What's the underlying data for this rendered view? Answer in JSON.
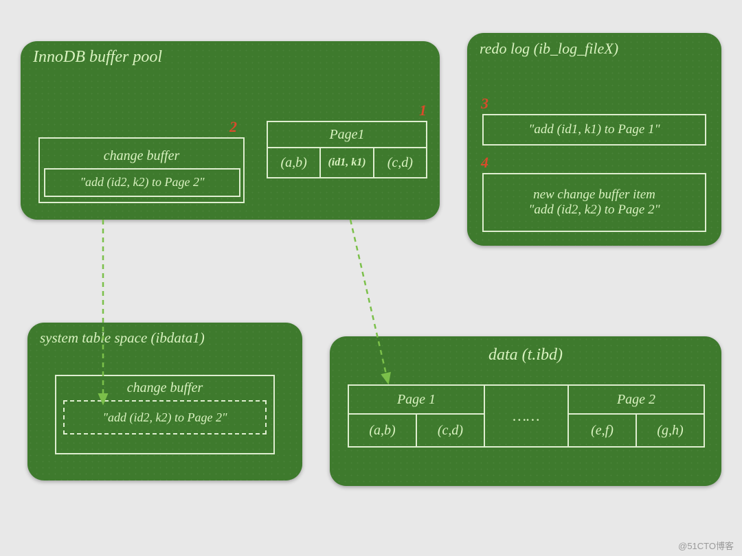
{
  "watermark": "@51CTO博客",
  "bufferPool": {
    "title": "InnoDB buffer pool",
    "changeBuffer": {
      "label": "change buffer",
      "entry": "\"add (id2, k2) to Page 2\"",
      "stepLabel": "2"
    },
    "page1": {
      "label": "Page1",
      "cells": [
        "(a,b)",
        "(id1, k1)",
        "(c,d)"
      ],
      "stepLabel": "1"
    }
  },
  "redoLog": {
    "title": "redo log (ib_log_fileX)",
    "entry3": {
      "step": "3",
      "text": "\"add (id1, k1) to Page 1\""
    },
    "entry4": {
      "step": "4",
      "line1": "new change buffer item",
      "line2": "\"add (id2, k2) to Page 2\""
    }
  },
  "systemTS": {
    "title": "system table space (ibdata1)",
    "changeBuffer": {
      "label": "change buffer",
      "entry": "\"add (id2, k2) to Page 2\""
    }
  },
  "dataFile": {
    "title": "data (t.ibd)",
    "page1": {
      "label": "Page 1",
      "cells": [
        "(a,b)",
        "(c,d)"
      ]
    },
    "gap": "……",
    "page2": {
      "label": "Page 2",
      "cells": [
        "(e,f)",
        "(g,h)"
      ]
    }
  }
}
